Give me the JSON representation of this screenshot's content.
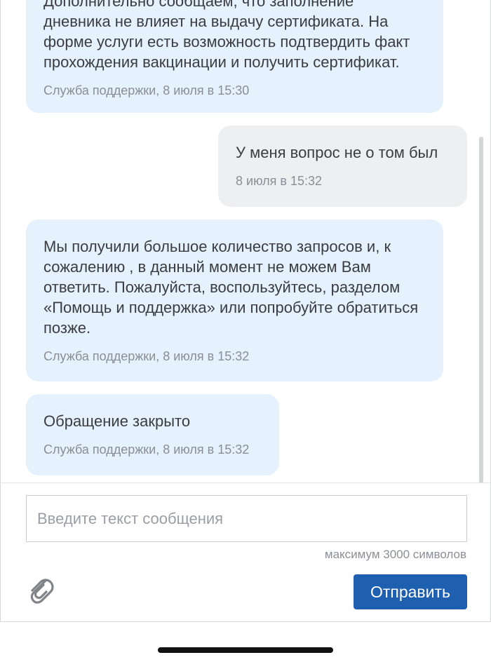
{
  "messages": [
    {
      "sender": "support",
      "text": "Дополнительно сообщаем, что заполнение\nдневника не влияет на выдачу сертификата. На\nформе услуги есть возможность подтвердить факт\nпрохождения вакцинации и получить сертификат.",
      "meta": "Служба поддержки, 8 июля в 15:30"
    },
    {
      "sender": "user",
      "text": "У меня вопрос не о том был",
      "meta": "8 июля в 15:32"
    },
    {
      "sender": "support",
      "text": "Мы получили большое количество запросов и, к\nсожалению , в данный момент не можем Вам\nответить. Пожалуйста, воспользуйтесь, разделом\n«Помощь и поддержка» или попробуйте обратиться\nпозже.",
      "meta": "Служба поддержки, 8 июля в 15:32"
    },
    {
      "sender": "support",
      "text": "Обращение закрыто",
      "meta": "Служба поддержки, 8 июля в 15:32"
    }
  ],
  "composer": {
    "placeholder": "Введите текст сообщения",
    "value": "",
    "limit_text": "максимум 3000 символов",
    "attach_icon": "paperclip-icon",
    "send_label": "Отправить"
  },
  "colors": {
    "support_bubble": "#e5f1fc",
    "user_bubble": "#eeeff1",
    "send_button": "#1e5fb0"
  }
}
